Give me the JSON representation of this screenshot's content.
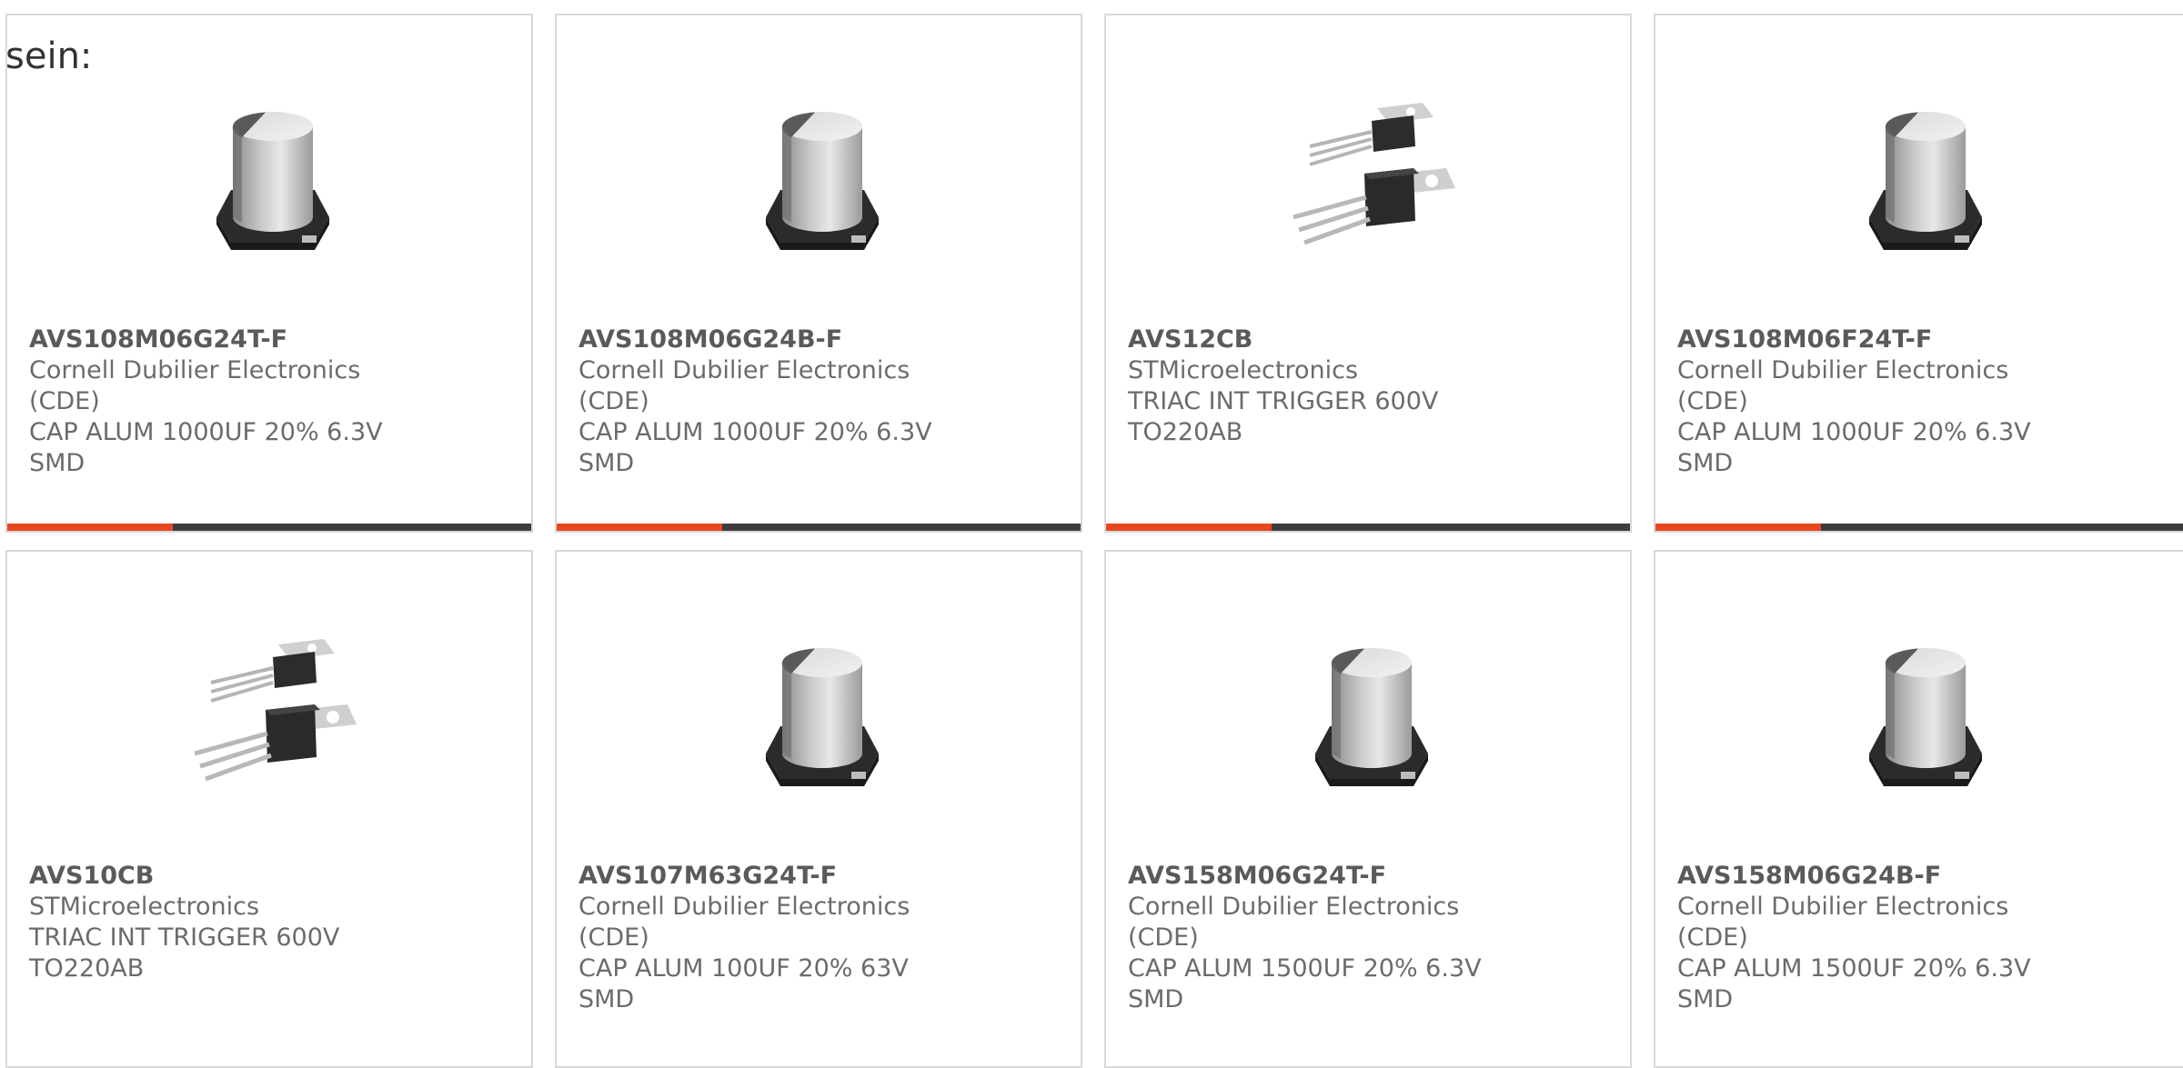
{
  "lead_text": "sein:",
  "accent_color": "#e8461f",
  "products": [
    {
      "part": "AVS108M06G24T-F",
      "manufacturer": "Cornell Dubilier Electronics (CDE)",
      "description": "CAP ALUM 1000UF 20% 6.3V SMD",
      "image": "capacitor-image"
    },
    {
      "part": "AVS108M06G24B-F",
      "manufacturer": "Cornell Dubilier Electronics (CDE)",
      "description": "CAP ALUM 1000UF 20% 6.3V SMD",
      "image": "capacitor-image"
    },
    {
      "part": "AVS12CB",
      "manufacturer": "STMicroelectronics",
      "description": "TRIAC INT TRIGGER 600V TO220AB",
      "image": "to220-image"
    },
    {
      "part": "AVS108M06F24T-F",
      "manufacturer": "Cornell Dubilier Electronics (CDE)",
      "description": "CAP ALUM 1000UF 20% 6.3V SMD",
      "image": "capacitor-image"
    },
    {
      "part": "AVS10CB",
      "manufacturer": "STMicroelectronics",
      "description": "TRIAC INT TRIGGER 600V TO220AB",
      "image": "to220-image"
    },
    {
      "part": "AVS107M63G24T-F",
      "manufacturer": "Cornell Dubilier Electronics (CDE)",
      "description": "CAP ALUM 100UF 20% 63V SMD",
      "image": "capacitor-image"
    },
    {
      "part": "AVS158M06G24T-F",
      "manufacturer": "Cornell Dubilier Electronics (CDE)",
      "description": "CAP ALUM 1500UF 20% 6.3V SMD",
      "image": "capacitor-image"
    },
    {
      "part": "AVS158M06G24B-F",
      "manufacturer": "Cornell Dubilier Electronics (CDE)",
      "description": "CAP ALUM 1500UF 20% 6.3V SMD",
      "image": "capacitor-image"
    }
  ]
}
